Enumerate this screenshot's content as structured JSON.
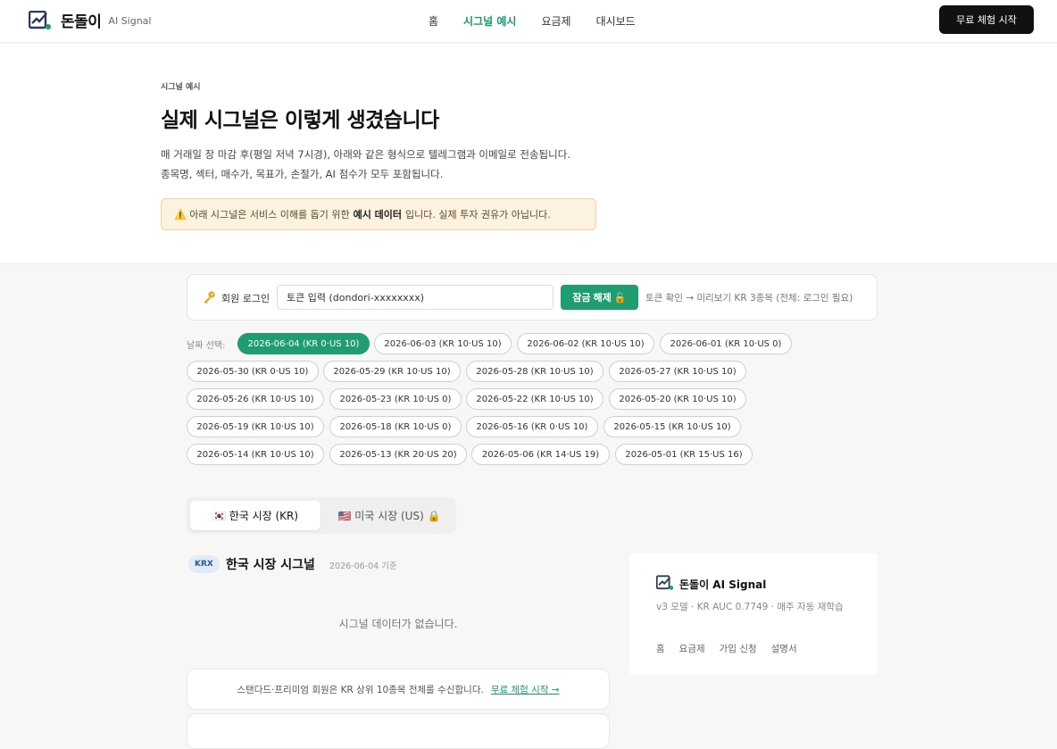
{
  "header": {
    "brand": "돈돌이",
    "brand_sub": "AI Signal",
    "nav": [
      "홈",
      "시그널 예시",
      "요금제",
      "대시보드"
    ],
    "active_nav": 1,
    "cta": "무료 체험 시작"
  },
  "hero": {
    "eyebrow": "시그널 예시",
    "title": "실제 시그널은 이렇게 생겼습니다",
    "desc_line1": "매 거래일 장 마감 후(평일 저녁 7시경), 아래와 같은 형식으로 텔레그램과 이메일로 전송됩니다.",
    "desc_line2": "종목명, 섹터, 매수가, 목표가, 손절가, AI 점수가 모두 포함됩니다.",
    "notice_pre": "⚠️ 아래 시그널은 서비스 이해를 돕기 위한",
    "notice_bold": "예시 데이터",
    "notice_post": "입니다. 실제 투자 권유가 아닙니다."
  },
  "login": {
    "label": "회원 로그인",
    "placeholder": "토큰 입력 (dondori-xxxxxxxx)",
    "unlock": "잠금 해제 🔓",
    "hint": "토큰 확인 → 미리보기 KR 3종목 (전체: 로그인 필요)"
  },
  "dates": {
    "label": "날짜 선택:",
    "selected": 0,
    "items": [
      "2026-06-04 (KR 0·US 10)",
      "2026-06-03 (KR 10·US 10)",
      "2026-06-02 (KR 10·US 10)",
      "2026-06-01 (KR 10·US 0)",
      "2026-05-30 (KR 0·US 10)",
      "2026-05-29 (KR 10·US 10)",
      "2026-05-28 (KR 10·US 10)",
      "2026-05-27 (KR 10·US 10)",
      "2026-05-26 (KR 10·US 10)",
      "2026-05-23 (KR 10·US 0)",
      "2026-05-22 (KR 10·US 10)",
      "2026-05-20 (KR 10·US 10)",
      "2026-05-19 (KR 10·US 10)",
      "2026-05-18 (KR 10·US 0)",
      "2026-05-16 (KR 0·US 10)",
      "2026-05-15 (KR 10·US 10)",
      "2026-05-14 (KR 10·US 10)",
      "2026-05-13 (KR 20·US 20)",
      "2026-05-06 (KR 14·US 19)",
      "2026-05-01 (KR 15·US 16)"
    ]
  },
  "tabs": {
    "kr": "🇰🇷 한국 시장 (KR)",
    "us": "🇺🇸 미국 시장 (US) 🔒"
  },
  "section": {
    "badge": "KRX",
    "title": "한국 시장 시그널",
    "date": "2026-06-04 기준",
    "empty": "시그널 데이터가 없습니다.",
    "upsell_text": "스탠다드·프리미엄 회원은 KR 상위 10종목 전체를 수신합니다.",
    "upsell_link": "무료 체험 시작 →"
  },
  "card": {
    "title": "돈돌이 AI Signal",
    "desc": "v3 모델 · KR AUC 0.7749 · 매주 자동 재학습",
    "links": [
      "홈",
      "요금제",
      "가입 신청",
      "설명서"
    ]
  },
  "colors": {
    "accent": "#1f9d70",
    "notice_bg": "#fdf2e0",
    "badge_bg": "#e1ecf8"
  },
  "icons": {
    "logo": "chart-check-logo-icon",
    "key": "key-icon",
    "lock": "lock-icon"
  }
}
